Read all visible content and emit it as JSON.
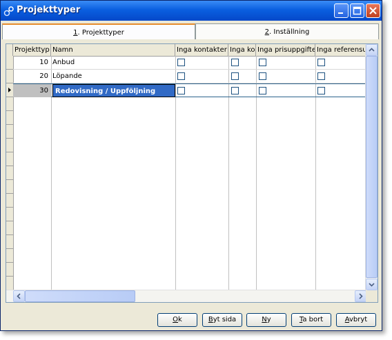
{
  "window": {
    "title": "Projekttyper"
  },
  "tabs": [
    {
      "accel": "1",
      "label": ". Projekttyper",
      "active": true
    },
    {
      "accel": "2",
      "label": ". Inställning",
      "active": false
    }
  ],
  "grid": {
    "columns": [
      "Projekttyp",
      "Namn",
      "Inga kontakter",
      "Inga kor",
      "Inga prisuppgifter",
      "Inga referensu"
    ],
    "rows": [
      {
        "typ": "10",
        "namn": "Anbud",
        "checks": [
          false,
          false,
          false,
          false
        ]
      },
      {
        "typ": "20",
        "namn": "Löpande",
        "checks": [
          false,
          false,
          false,
          false
        ]
      },
      {
        "typ": "30",
        "namn": "Redovisning / Uppföljning",
        "checks": [
          false,
          false,
          false,
          false
        ],
        "selected": true
      }
    ]
  },
  "buttons": [
    {
      "accel": "O",
      "rest": "k"
    },
    {
      "accel": "B",
      "rest": "yt sida"
    },
    {
      "accel": "N",
      "rest": "y"
    },
    {
      "accel": "T",
      "rest": "a bort"
    },
    {
      "accel": "A",
      "rest": "vbryt"
    }
  ],
  "colors": {
    "titlebar": "#0a5fe0",
    "selection": "#316ac5",
    "tab_highlight": "#e68b2c"
  }
}
